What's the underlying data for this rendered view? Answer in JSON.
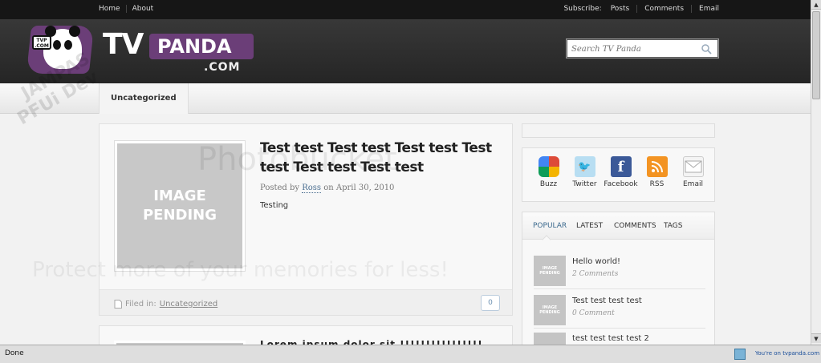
{
  "topbar": {
    "nav": [
      "Home",
      "About"
    ],
    "subscribe_label": "Subscribe:",
    "subscribe_links": [
      "Posts",
      "Comments",
      "Email"
    ]
  },
  "header": {
    "logo_tag": "TVP .COM",
    "logo_word1": "TV",
    "logo_word2": "PANDA",
    "logo_dotcom": ".COM",
    "search_placeholder": "Search TV Panda"
  },
  "catbar": {
    "active_category": "Uncategorized"
  },
  "posts": [
    {
      "title": "Test test Test test Test test Test test Test test Test test",
      "meta_prefix": "Posted by",
      "author": "Ross",
      "date_prefix": "on",
      "date": "April 30, 2010",
      "excerpt": "Testing",
      "thumb_line1": "IMAGE",
      "thumb_line2": "PENDING",
      "filed_label": "Filed in:",
      "filed_category": "Uncategorized",
      "comment_count": "0"
    },
    {
      "title": "Lorem ipsum dolor sit !!!!!!!!!!!!!!!!"
    }
  ],
  "sidebar": {
    "social": [
      {
        "label": "Buzz",
        "icon": "buzz-icon",
        "color": "#e8e8e8"
      },
      {
        "label": "Twitter",
        "icon": "twitter-icon",
        "color": "#b8def2"
      },
      {
        "label": "Facebook",
        "icon": "facebook-icon",
        "color": "#3b5998"
      },
      {
        "label": "RSS",
        "icon": "rss-icon",
        "color": "#f39423"
      },
      {
        "label": "Email",
        "icon": "email-icon",
        "color": "#f0f0f0"
      }
    ],
    "tabs": [
      "POPULAR",
      "LATEST",
      "COMMENTS",
      "TAGS"
    ],
    "active_tab": "POPULAR",
    "entries": [
      {
        "title": "Hello world!",
        "count": "2 Comments"
      },
      {
        "title": "Test test test test",
        "count": "0 Comment"
      },
      {
        "title": "test test test test 2",
        "count": ""
      }
    ],
    "mini_thumb_line1": "IMAGE",
    "mini_thumb_line2": "PENDING"
  },
  "statusbar": {
    "status": "Done",
    "zone": "You're on tvpanda.com"
  },
  "watermark": {
    "line1": "Photobucket",
    "line2": "Protect more of your memories for less!",
    "corner1": "JAMPAS",
    "corner2": "PFUi Dev"
  },
  "colors": {
    "header_bg": "#252525",
    "logo_purple": "#6b3e78",
    "link_blue": "#4a6e90",
    "tab_active": "#3c6a8e"
  }
}
